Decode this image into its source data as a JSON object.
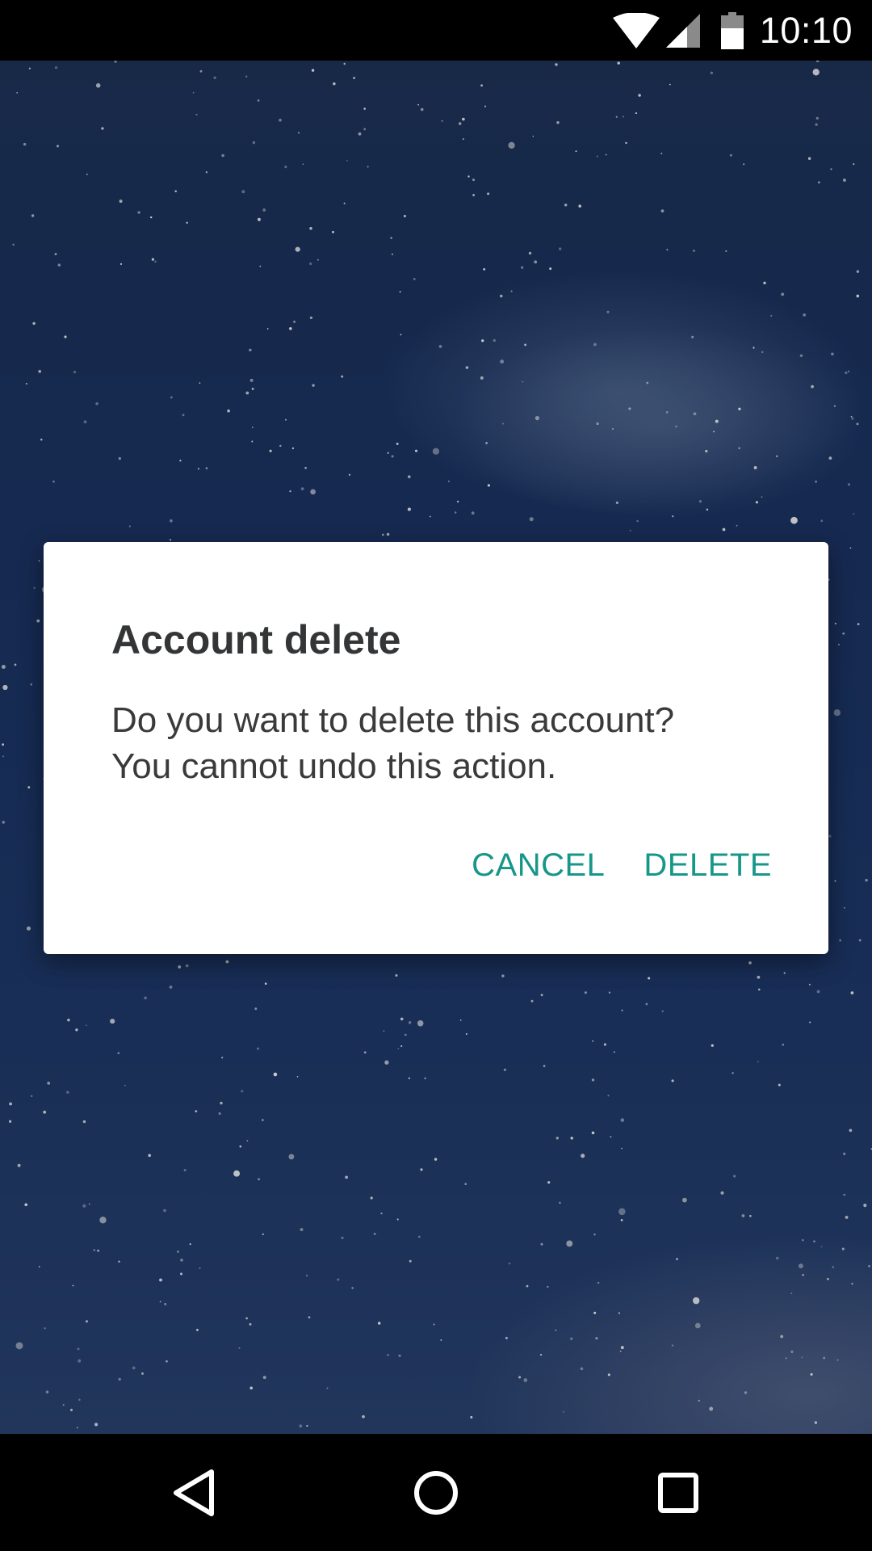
{
  "status_bar": {
    "time": "10:10",
    "icons": [
      "wifi-icon",
      "signal-icon",
      "battery-icon"
    ]
  },
  "dialog": {
    "title": "Account delete",
    "message_line1": "Do you want to delete this account?",
    "message_line2": "You cannot undo this action.",
    "cancel_label": "CANCEL",
    "delete_label": "DELETE"
  },
  "nav_bar": {
    "buttons": [
      "back-icon",
      "home-icon",
      "recents-icon"
    ]
  },
  "colors": {
    "accent": "#17968a",
    "dialog_bg": "#ffffff",
    "title_text": "#333536",
    "body_text": "#3a3a3a",
    "wallpaper_base": "#1c3566"
  }
}
